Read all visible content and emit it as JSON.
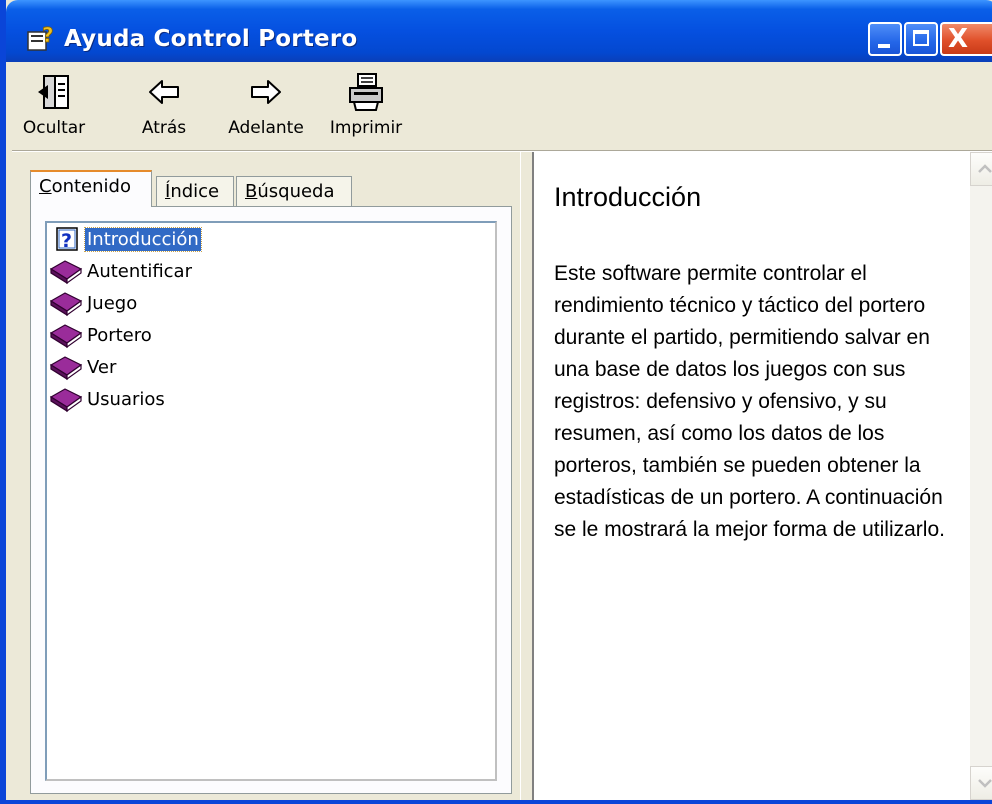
{
  "window": {
    "title": "Ayuda Control Portero",
    "title_icon": "help-book-icon",
    "controls": {
      "minimize": "minimize-icon",
      "maximize": "maximize-icon",
      "close_glyph": "X"
    },
    "colors": {
      "titlebar": "#0550e0",
      "close": "#e0502a",
      "selection": "#316ac5"
    }
  },
  "toolbar": {
    "items": [
      {
        "label": "Ocultar",
        "icon": "hide-pane-icon"
      },
      {
        "label": "Atrás",
        "icon": "back-arrow-icon"
      },
      {
        "label": "Adelante",
        "icon": "forward-arrow-icon"
      },
      {
        "label": "Imprimir",
        "icon": "printer-icon"
      }
    ]
  },
  "tabs": [
    {
      "first": "C",
      "rest": "ontenido",
      "active": true
    },
    {
      "first": "Í",
      "rest": "ndice",
      "active": false
    },
    {
      "first": "B",
      "rest": "úsqueda",
      "active": false
    }
  ],
  "tree": {
    "items": [
      {
        "label": "Introducción",
        "icon": "help-page-icon",
        "selected": true
      },
      {
        "label": "Autentificar",
        "icon": "book-icon"
      },
      {
        "label": "Juego",
        "icon": "book-icon"
      },
      {
        "label": "Portero",
        "icon": "book-icon"
      },
      {
        "label": "Ver",
        "icon": "book-icon"
      },
      {
        "label": "Usuarios",
        "icon": "book-icon"
      }
    ]
  },
  "topic": {
    "heading": "Introducción",
    "body": "Este software permite controlar el rendimiento técnico y táctico del portero durante el partido, permitiendo salvar en una base de datos los juegos con sus registros: defensivo y ofensivo, y su resumen, así como los datos de los  porteros, también se pueden obtener la estadísticas de un portero. A continuación se le mostrará la mejor forma de utilizarlo."
  }
}
